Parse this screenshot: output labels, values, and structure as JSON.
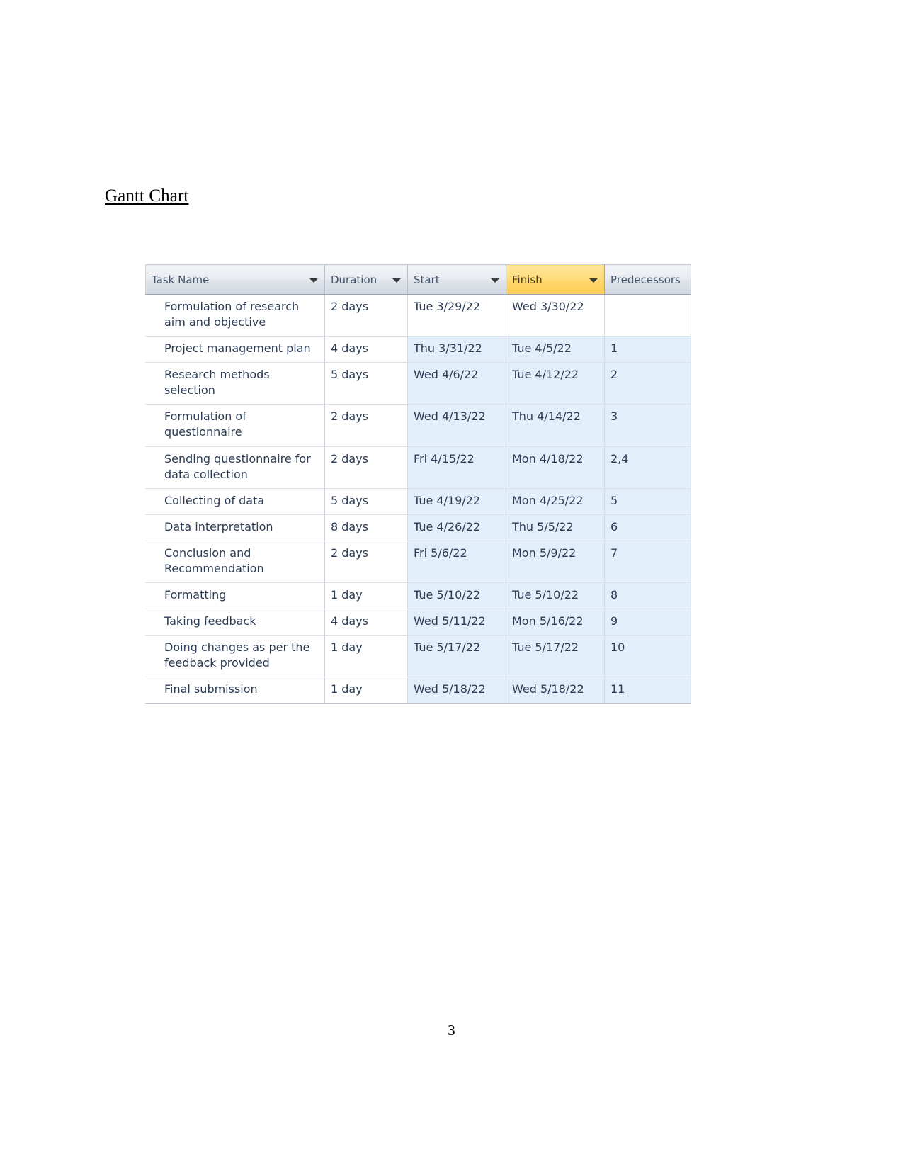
{
  "document": {
    "heading": "Gantt Chart",
    "page_number": "3"
  },
  "colors": {
    "header_highlight": "#FFD76E",
    "row_shade": "#E3EEFB",
    "header_text": "#44546A",
    "body_text": "#2C3C54"
  },
  "table": {
    "columns": [
      {
        "key": "task",
        "label": "Task Name",
        "has_filter": true,
        "highlighted": false
      },
      {
        "key": "duration",
        "label": "Duration",
        "has_filter": true,
        "highlighted": false
      },
      {
        "key": "start",
        "label": "Start",
        "has_filter": true,
        "highlighted": false
      },
      {
        "key": "finish",
        "label": "Finish",
        "has_filter": true,
        "highlighted": true
      },
      {
        "key": "pred",
        "label": "Predecessors",
        "has_filter": false,
        "highlighted": false
      }
    ],
    "rows": [
      {
        "task": "Formulation of research aim and objective",
        "duration": "2 days",
        "start": "Tue 3/29/22",
        "finish": "Wed 3/30/22",
        "pred": "",
        "shaded": false
      },
      {
        "task": "Project management plan",
        "duration": "4 days",
        "start": "Thu 3/31/22",
        "finish": "Tue 4/5/22",
        "pred": "1",
        "shaded": true
      },
      {
        "task": "Research methods selection",
        "duration": "5 days",
        "start": "Wed 4/6/22",
        "finish": "Tue 4/12/22",
        "pred": "2",
        "shaded": true
      },
      {
        "task": "Formulation of questionnaire",
        "duration": "2 days",
        "start": "Wed 4/13/22",
        "finish": "Thu 4/14/22",
        "pred": "3",
        "shaded": true
      },
      {
        "task": "Sending questionnaire for data collection",
        "duration": "2 days",
        "start": "Fri 4/15/22",
        "finish": "Mon 4/18/22",
        "pred": "2,4",
        "shaded": true
      },
      {
        "task": "Collecting of data",
        "duration": "5 days",
        "start": "Tue 4/19/22",
        "finish": "Mon 4/25/22",
        "pred": "5",
        "shaded": true
      },
      {
        "task": "Data interpretation",
        "duration": "8 days",
        "start": "Tue 4/26/22",
        "finish": "Thu 5/5/22",
        "pred": "6",
        "shaded": true
      },
      {
        "task": "Conclusion and Recommendation",
        "duration": "2 days",
        "start": "Fri 5/6/22",
        "finish": "Mon 5/9/22",
        "pred": "7",
        "shaded": true
      },
      {
        "task": "Formatting",
        "duration": "1 day",
        "start": "Tue 5/10/22",
        "finish": "Tue 5/10/22",
        "pred": "8",
        "shaded": true
      },
      {
        "task": "Taking feedback",
        "duration": "4 days",
        "start": "Wed 5/11/22",
        "finish": "Mon 5/16/22",
        "pred": "9",
        "shaded": true
      },
      {
        "task": "Doing changes as per the feedback provided",
        "duration": "1 day",
        "start": "Tue 5/17/22",
        "finish": "Tue 5/17/22",
        "pred": "10",
        "shaded": true
      },
      {
        "task": "Final submission",
        "duration": "1 day",
        "start": "Wed 5/18/22",
        "finish": "Wed 5/18/22",
        "pred": "11",
        "shaded": true
      }
    ]
  }
}
